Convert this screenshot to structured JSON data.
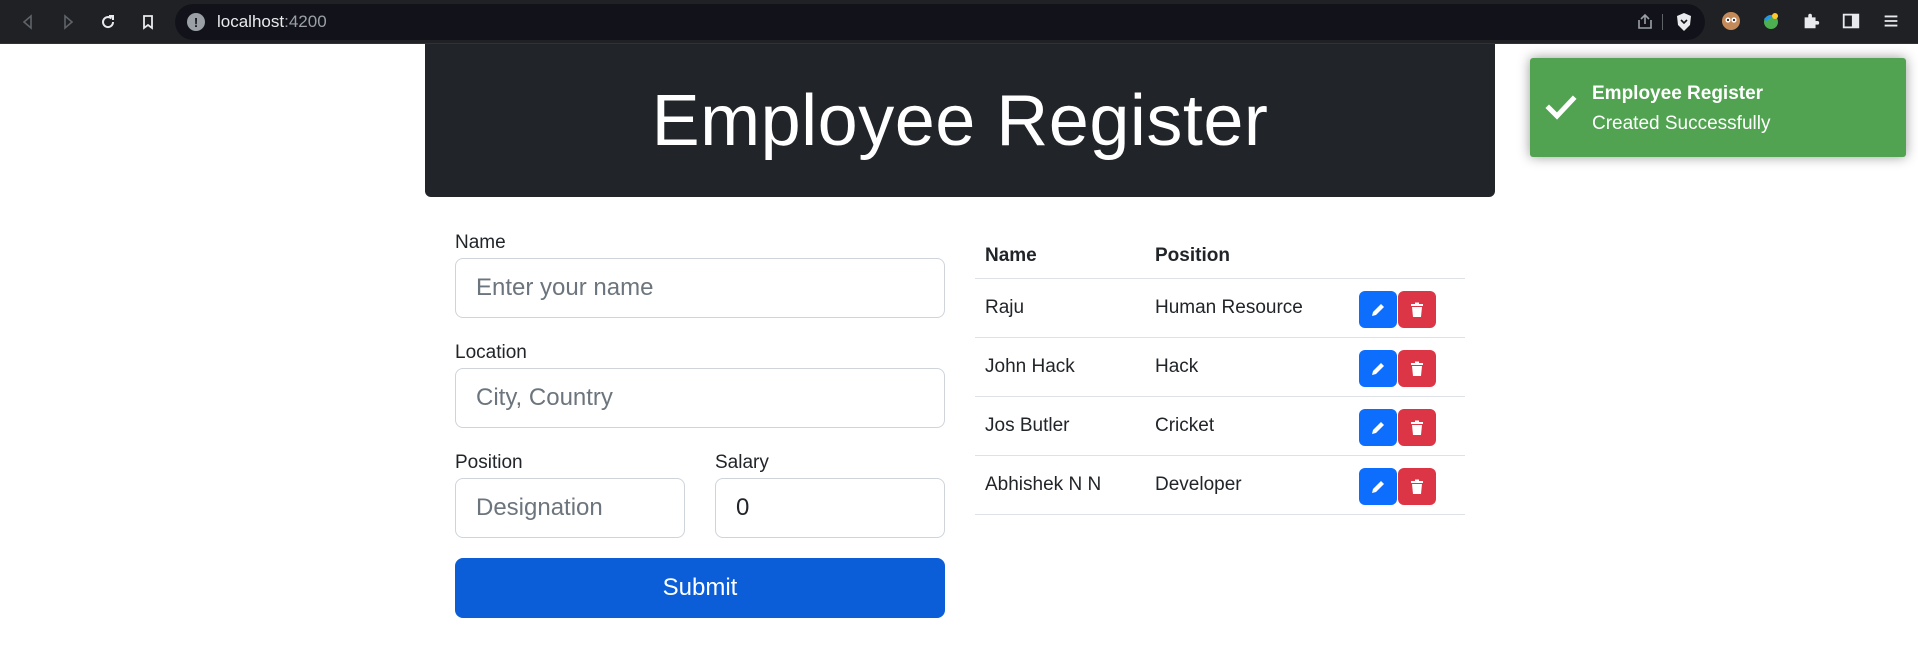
{
  "browser": {
    "url_host": "localhost",
    "url_port": ":4200"
  },
  "header": {
    "title": "Employee Register"
  },
  "form": {
    "name_label": "Name",
    "name_placeholder": "Enter your name",
    "location_label": "Location",
    "location_placeholder": "City, Country",
    "position_label": "Position",
    "position_placeholder": "Designation",
    "salary_label": "Salary",
    "salary_value": "0",
    "submit_label": "Submit"
  },
  "table": {
    "headers": [
      "Name",
      "Position"
    ],
    "rows": [
      {
        "name": "Raju",
        "position": "Human Resource"
      },
      {
        "name": "John Hack",
        "position": "Hack"
      },
      {
        "name": "Jos Butler",
        "position": "Cricket"
      },
      {
        "name": "Abhishek N N",
        "position": "Developer"
      }
    ]
  },
  "toast": {
    "title": "Employee Register",
    "message": "Created Successfully",
    "color": "#51a351"
  },
  "icons": {
    "edit": "pencil-icon",
    "delete": "trash-icon"
  }
}
